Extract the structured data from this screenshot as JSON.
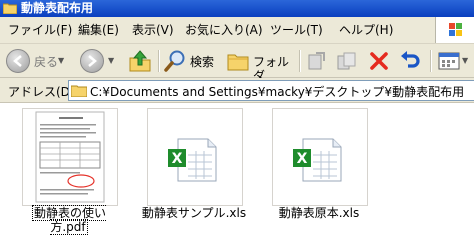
{
  "window": {
    "title": "動静表配布用"
  },
  "menu": {
    "items": [
      "ファイル(F)",
      "編集(E)",
      "表示(V)",
      "お気に入り(A)",
      "ツール(T)",
      "ヘルプ(H)"
    ]
  },
  "toolbar": {
    "back_label": "戻る",
    "search_label": "検索",
    "folders_label": "フォルダ"
  },
  "address": {
    "label": "アドレス(D)",
    "path": "C:¥Documents and Settings¥macky¥デスクトップ¥動静表配布用"
  },
  "files": [
    {
      "name": "動静表の使い方.pdf",
      "type": "pdf",
      "selected": true
    },
    {
      "name": "動静表サンプル.xls",
      "type": "xls",
      "selected": false
    },
    {
      "name": "動静表原本.xls",
      "type": "xls",
      "selected": false
    }
  ],
  "icons": {
    "back": "back-arrow-icon",
    "forward": "forward-arrow-icon",
    "up": "up-folder-icon",
    "search": "search-icon",
    "folders": "folders-icon",
    "moveto": "move-to-icon",
    "copyto": "copy-to-icon",
    "delete": "delete-icon",
    "undo": "undo-icon",
    "views": "views-icon"
  },
  "colors": {
    "titlebar": "#0a3fbf",
    "delete": "#e52b1f",
    "undo": "#1a56c6",
    "excel": "#1e8c2c"
  }
}
